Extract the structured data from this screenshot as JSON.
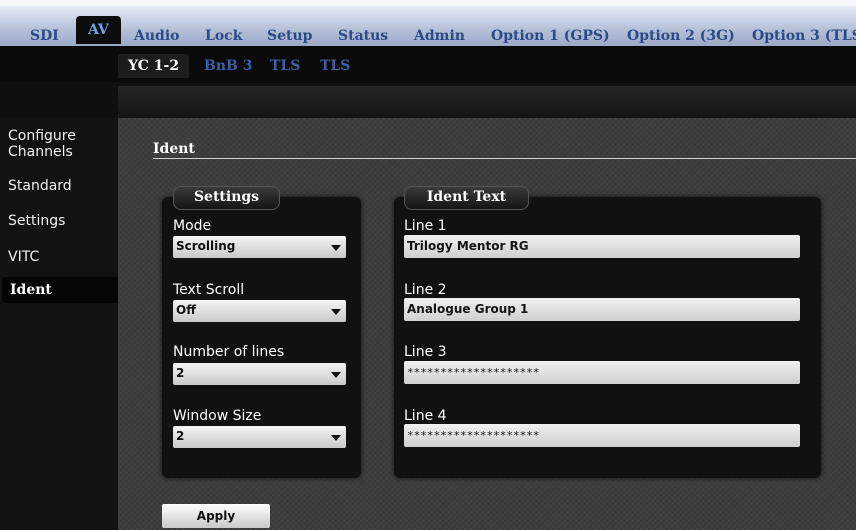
{
  "main_nav": [
    {
      "label": "SDI"
    },
    {
      "label": "AV"
    },
    {
      "label": "Audio"
    },
    {
      "label": "Lock"
    },
    {
      "label": "Setup"
    },
    {
      "label": "Status"
    },
    {
      "label": "Admin"
    },
    {
      "label": "Option 1 (GPS)"
    },
    {
      "label": "Option 2 (3G)"
    },
    {
      "label": "Option 3 (TLS"
    }
  ],
  "sub_nav": [
    {
      "label": "YC 1-2"
    },
    {
      "label": "BnB 3"
    },
    {
      "label": "TLS"
    },
    {
      "label": "TLS"
    }
  ],
  "sidebar": [
    {
      "label": "Configure Channels"
    },
    {
      "label": "Standard"
    },
    {
      "label": "Settings"
    },
    {
      "label": "VITC"
    },
    {
      "label": "Ident"
    }
  ],
  "section": {
    "title": "Ident"
  },
  "settings_panel": {
    "title": "Settings",
    "mode": {
      "label": "Mode",
      "value": "Scrolling"
    },
    "text_scroll": {
      "label": "Text Scroll",
      "value": "Off"
    },
    "number_of_lines": {
      "label": "Number of lines",
      "value": "2"
    },
    "window_size": {
      "label": "Window Size",
      "value": "2"
    }
  },
  "ident_text_panel": {
    "title": "Ident Text",
    "line1": {
      "label": "Line 1",
      "value": "Trilogy Mentor RG"
    },
    "line2": {
      "label": "Line 2",
      "value": "Analogue Group 1"
    },
    "line3": {
      "label": "Line 3",
      "value": "********************"
    },
    "line4": {
      "label": "Line 4",
      "value": "********************"
    }
  },
  "apply_button": {
    "label": "Apply"
  },
  "colors": {
    "nav_text": "#2b4a86",
    "nav_active": "#6fa1ea",
    "subnav_inactive": "#3d5fa2"
  }
}
